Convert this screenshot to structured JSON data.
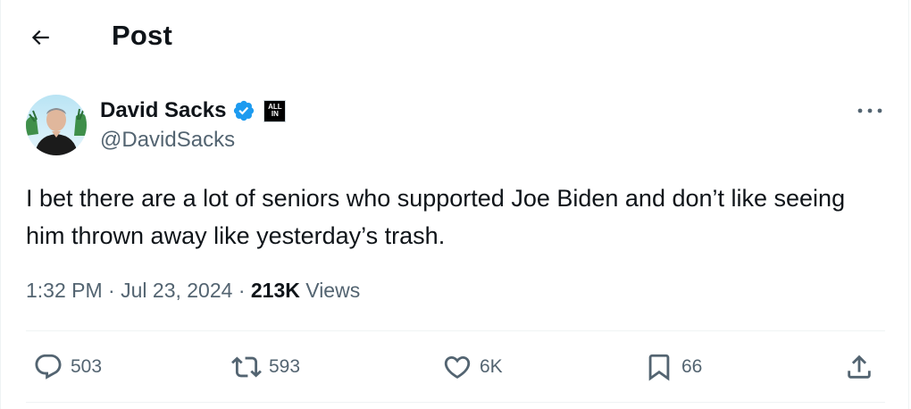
{
  "header": {
    "title": "Post"
  },
  "author": {
    "name": "David Sacks",
    "handle": "@DavidSacks",
    "affiliate_badge": "ALL IN",
    "verified_color": "#1d9bf0"
  },
  "tweet": {
    "text": "I bet there are a lot of seniors who supported Joe Biden and don’t like seeing him thrown away like yesterday’s trash."
  },
  "meta": {
    "time": "1:32 PM",
    "date": "Jul 23, 2024",
    "views_count": "213K",
    "views_label": "Views"
  },
  "actions": {
    "replies": "503",
    "reposts": "593",
    "likes": "6K",
    "bookmarks": "66"
  },
  "icons": {
    "back": "back-arrow-icon",
    "verified": "verified-badge-icon",
    "more": "more-icon",
    "reply": "reply-icon",
    "repost": "repost-icon",
    "like": "heart-icon",
    "bookmark": "bookmark-icon",
    "share": "share-icon"
  }
}
